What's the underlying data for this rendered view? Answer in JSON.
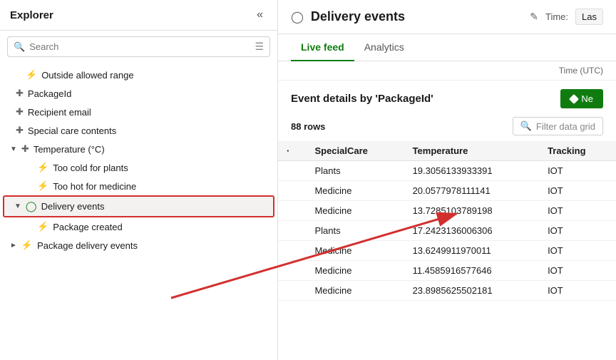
{
  "sidebar": {
    "title": "Explorer",
    "search_placeholder": "Search",
    "items": [
      {
        "id": "outside-allowed-range",
        "label": "Outside allowed range",
        "icon": "bolt",
        "indent": 2
      },
      {
        "id": "packageid",
        "label": "PackageId",
        "icon": "tag",
        "indent": 1
      },
      {
        "id": "recipient-email",
        "label": "Recipient email",
        "icon": "tag",
        "indent": 1
      },
      {
        "id": "special-care-contents",
        "label": "Special care contents",
        "icon": "tag",
        "indent": 1
      },
      {
        "id": "temperature",
        "label": "Temperature (°C)",
        "icon": "tag",
        "indent": 1,
        "expanded": true,
        "chevron": true
      },
      {
        "id": "too-cold",
        "label": "Too cold for plants",
        "icon": "bolt",
        "indent": 2
      },
      {
        "id": "too-hot",
        "label": "Too hot for medicine",
        "icon": "bolt",
        "indent": 2
      },
      {
        "id": "delivery-events",
        "label": "Delivery events",
        "icon": "events",
        "indent": 1,
        "expanded": true,
        "chevron": true,
        "highlighted": true
      },
      {
        "id": "package-created",
        "label": "Package created",
        "icon": "bolt",
        "indent": 2
      },
      {
        "id": "package-delivery-events",
        "label": "Package delivery events",
        "icon": "lightning",
        "indent": 1,
        "chevron": true
      }
    ]
  },
  "main": {
    "title": "Delivery events",
    "time_label": "Time:",
    "time_value": "Las",
    "tabs": [
      {
        "id": "live-feed",
        "label": "Live feed",
        "active": true
      },
      {
        "id": "analytics",
        "label": "Analytics",
        "active": false
      }
    ],
    "time_utc_header": "Time (UTC)",
    "event_details": {
      "title": "Event details by 'PackageId'",
      "new_button_label": "Ne",
      "rows_count": "88 rows",
      "filter_placeholder": "Filter data grid"
    },
    "table": {
      "columns": [
        "·",
        "SpecialCare",
        "Temperature",
        "Tracking"
      ],
      "rows": [
        {
          "dot": "",
          "specialCare": "Plants",
          "temperature": "19.3056133933391",
          "tracking": "IOT"
        },
        {
          "dot": "",
          "specialCare": "Medicine",
          "temperature": "20.0577978111141",
          "tracking": "IOT"
        },
        {
          "dot": "",
          "specialCare": "Medicine",
          "temperature": "13.7285103789198",
          "tracking": "IOT"
        },
        {
          "dot": "",
          "specialCare": "Plants",
          "temperature": "17.2423136006306",
          "tracking": "IOT"
        },
        {
          "dot": "",
          "specialCare": "Medicine",
          "temperature": "13.6249911970011",
          "tracking": "IOT"
        },
        {
          "dot": "",
          "specialCare": "Medicine",
          "temperature": "11.4585916577646",
          "tracking": "IOT"
        },
        {
          "dot": "",
          "specialCare": "Medicine",
          "temperature": "23.8985625502181",
          "tracking": "IOT"
        }
      ]
    }
  }
}
